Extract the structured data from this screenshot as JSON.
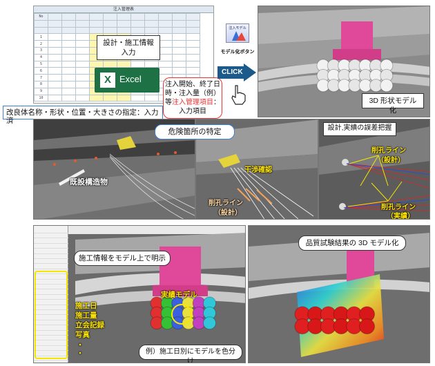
{
  "callouts": {
    "design_input": "設計・施工情報\n入力",
    "improved_body": "改良体名称・形状・位置・大きさの指定：入力済",
    "injection_info_l1": "注入開始、終了日",
    "injection_info_l2": "時・注入量（例）",
    "injection_info_l3_pre": "等",
    "injection_info_l3_red": "注入管理項目",
    "injection_info_l3_post": "：",
    "injection_info_l4": "入力項目",
    "model_3d": "3D 形状モデル化",
    "danger": "危険箇所の特定",
    "error_grasp": "設計,実績の誤差把握",
    "construction_info": "施工情報をモデル上で明示",
    "quality_model": "品質試験結果の 3D モデル化",
    "color_by_date": "例）施工日別にモデルを色分け"
  },
  "excel": {
    "icon": "X",
    "label": "Excel"
  },
  "model_button": {
    "icon_text": "注入モデル",
    "label": "モデル化ボタン"
  },
  "click_label": "CLICK",
  "labels": {
    "existing_structure": "既設構造物",
    "interference": "干渉確認",
    "drill_line_design_1": "削孔ライン",
    "drill_line_design_2": "（設計）",
    "drill_line_design_r1": "削孔ライン",
    "drill_line_design_r2": "（設計）",
    "drill_line_actual_1": "削孔ライン",
    "drill_line_actual_2": "（実績）",
    "actual_model": "実績モデル",
    "side_list_1": "施工日",
    "side_list_2": "施工量",
    "side_list_3": "立会記録",
    "side_list_4": "写真",
    "side_list_dots": "・"
  },
  "sheet": {
    "title": "注入管理表",
    "rows": [
      [
        "No",
        "",
        "",
        "",
        "",
        "",
        "",
        "",
        "",
        "",
        "",
        ""
      ],
      [
        "",
        "",
        "",
        "",
        "",
        "",
        "",
        "",
        "",
        "",
        "",
        ""
      ],
      [
        "",
        "",
        "",
        "",
        "",
        "",
        "",
        "",
        "",
        "",
        "",
        ""
      ],
      [
        "1",
        "",
        "",
        "",
        "",
        "",
        "",
        "",
        "",
        "",
        "",
        ""
      ],
      [
        "2",
        "",
        "",
        "",
        "",
        "",
        "",
        "",
        "",
        "",
        "",
        ""
      ],
      [
        "3",
        "",
        "",
        "",
        "",
        "",
        "",
        "",
        "",
        "",
        "",
        ""
      ],
      [
        "4",
        "",
        "",
        "",
        "",
        "",
        "",
        "",
        "",
        "",
        "",
        ""
      ],
      [
        "5",
        "",
        "",
        "",
        "",
        "",
        "",
        "",
        "",
        "",
        "",
        ""
      ],
      [
        "6",
        "",
        "",
        "",
        "",
        "",
        "",
        "",
        "",
        "",
        "",
        ""
      ],
      [
        "7",
        "",
        "",
        "",
        "",
        "",
        "",
        "",
        "",
        "",
        "",
        ""
      ],
      [
        "8",
        "",
        "",
        "",
        "",
        "",
        "",
        "",
        "",
        "",
        "",
        ""
      ],
      [
        "9",
        "",
        "",
        "",
        "",
        "",
        "",
        "",
        "",
        "",
        "",
        ""
      ],
      [
        "10",
        "",
        "",
        "",
        "",
        "",
        "",
        "",
        "",
        "",
        "",
        ""
      ]
    ]
  },
  "colors": {
    "accent_pink": "#e0489a",
    "yellow": "#ffe600",
    "blue_callout": "#3e7fd6",
    "red": "#e33333",
    "excel_green": "#1e7145"
  }
}
